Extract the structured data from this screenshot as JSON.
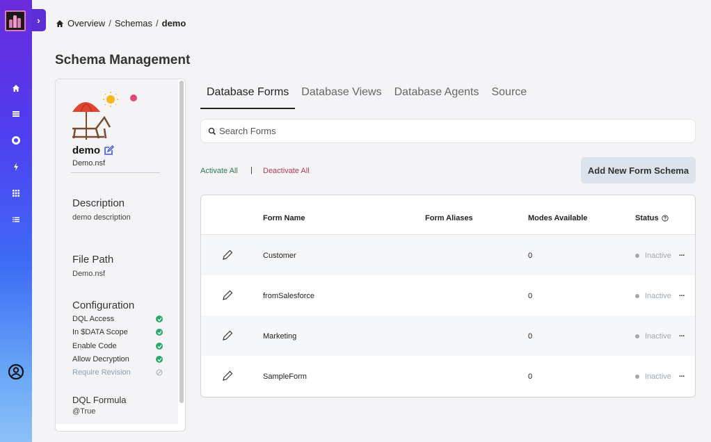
{
  "rail": {
    "expand_glyph": "›",
    "icons": [
      "home-icon",
      "list-icon",
      "circle-icon",
      "bolt-icon",
      "grid-icon",
      "menu-icon",
      "user-circle-icon"
    ]
  },
  "breadcrumb": {
    "items": [
      "Overview",
      "Schemas"
    ],
    "current": "demo",
    "separator": "/"
  },
  "page": {
    "title": "Schema Management"
  },
  "database": {
    "name": "demo",
    "file": "Demo.nsf",
    "description_title": "Description",
    "description": "demo description",
    "filepath_title": "File Path",
    "filepath": "Demo.nsf",
    "configuration_title": "Configuration",
    "configuration": [
      {
        "label": "DQL Access",
        "enabled": true
      },
      {
        "label": "In $DATA Scope",
        "enabled": true
      },
      {
        "label": "Enable Code",
        "enabled": true
      },
      {
        "label": "Allow Decryption",
        "enabled": true
      },
      {
        "label": "Require Revision",
        "enabled": false
      }
    ],
    "formula_title": "DQL Formula",
    "formula": "@True"
  },
  "tabs": [
    {
      "label": "Database Forms",
      "active": true
    },
    {
      "label": "Database Views",
      "active": false
    },
    {
      "label": "Database Agents",
      "active": false
    },
    {
      "label": "Source",
      "active": false
    }
  ],
  "search": {
    "placeholder": "Search Forms"
  },
  "actions": {
    "activate_all": "Activate All",
    "separator": "|",
    "deactivate_all": "Deactivate All",
    "add_button": "Add New Form Schema"
  },
  "table": {
    "headers": {
      "form_name": "Form Name",
      "form_aliases": "Form Aliases",
      "modes": "Modes Available",
      "status": "Status"
    },
    "rows": [
      {
        "name": "Customer",
        "aliases": "",
        "modes": "0",
        "status": "Inactive"
      },
      {
        "name": "fromSalesforce",
        "aliases": "",
        "modes": "0",
        "status": "Inactive"
      },
      {
        "name": "Marketing",
        "aliases": "",
        "modes": "0",
        "status": "Inactive"
      },
      {
        "name": "SampleForm",
        "aliases": "",
        "modes": "0",
        "status": "Inactive"
      }
    ],
    "more_glyph": "···"
  },
  "colors": {
    "rail_top": "#6a2bdc",
    "rail_bottom": "#8cc0f8",
    "activate": "#2d7a4a",
    "deactivate": "#b43a55",
    "check": "#2aa86d"
  }
}
